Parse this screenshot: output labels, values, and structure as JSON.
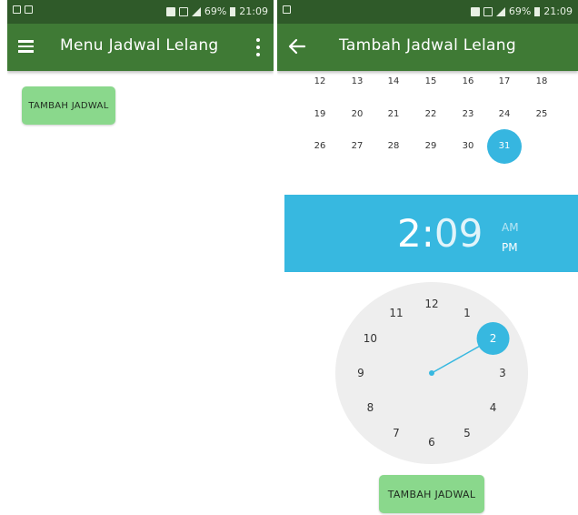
{
  "colors": {
    "status_bar": "#2f5a29",
    "app_bar": "#3f7a35",
    "button": "#8ad88c",
    "accent": "#37b8e0"
  },
  "status_bar": {
    "battery": "69%",
    "time": "21:09"
  },
  "left_screen": {
    "title": "Menu Jadwal Lelang",
    "add_button_label": "TAMBAH JADWAL"
  },
  "right_screen": {
    "title": "Tambah Jadwal Lelang",
    "calendar": {
      "rows": [
        [
          "12",
          "13",
          "14",
          "15",
          "16",
          "17",
          "18"
        ],
        [
          "19",
          "20",
          "21",
          "22",
          "23",
          "24",
          "25"
        ],
        [
          "26",
          "27",
          "28",
          "29",
          "30",
          "31"
        ]
      ],
      "selected_day": "31"
    },
    "time_picker": {
      "hour": "2",
      "separator": ":",
      "minute": "09",
      "am_label": "AM",
      "pm_label": "PM",
      "selected_period": "PM",
      "clock_numbers": [
        "12",
        "1",
        "2",
        "3",
        "4",
        "5",
        "6",
        "7",
        "8",
        "9",
        "10",
        "11"
      ],
      "selected_number": "2"
    },
    "add_button_label": "TAMBAH JADWAL"
  }
}
